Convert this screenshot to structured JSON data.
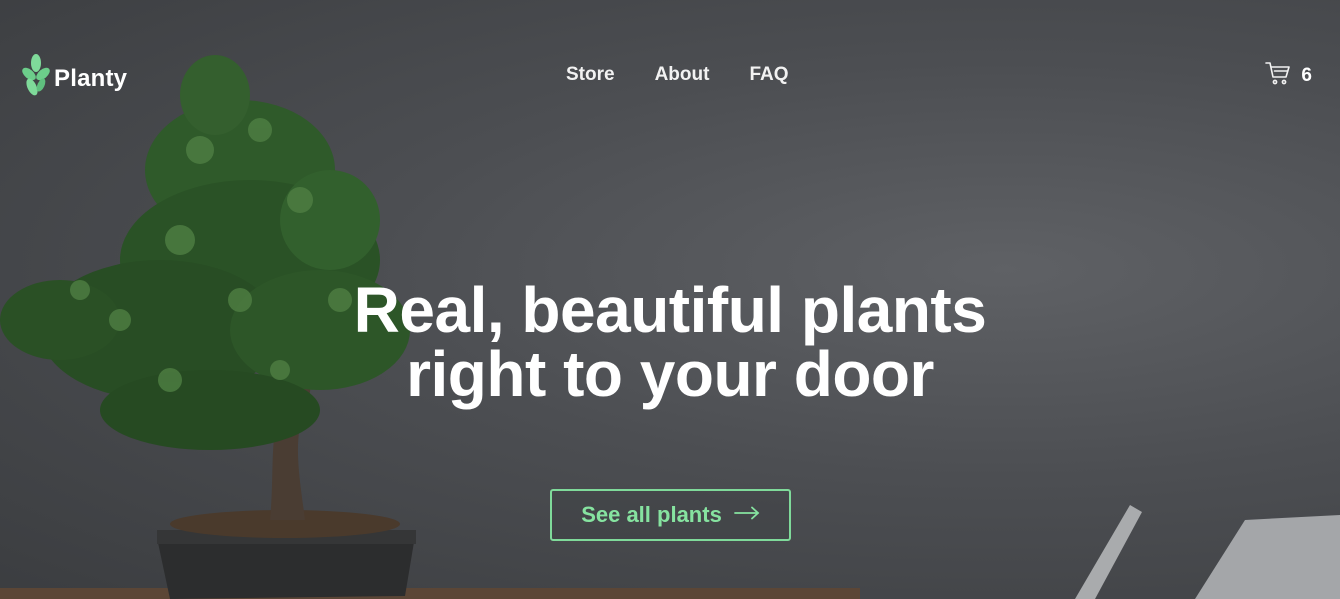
{
  "brand": {
    "name": "Planty",
    "accent": "#7fda9a",
    "logo_icon": "leaf-icon"
  },
  "nav": {
    "items": [
      "Store",
      "About",
      "FAQ"
    ]
  },
  "cart": {
    "icon": "cart-icon",
    "count": "6"
  },
  "hero": {
    "headline_line1": "Real, beautiful plants",
    "headline_line2": "right to your door",
    "cta_label": "See all plants",
    "cta_icon": "arrow-right-icon"
  }
}
